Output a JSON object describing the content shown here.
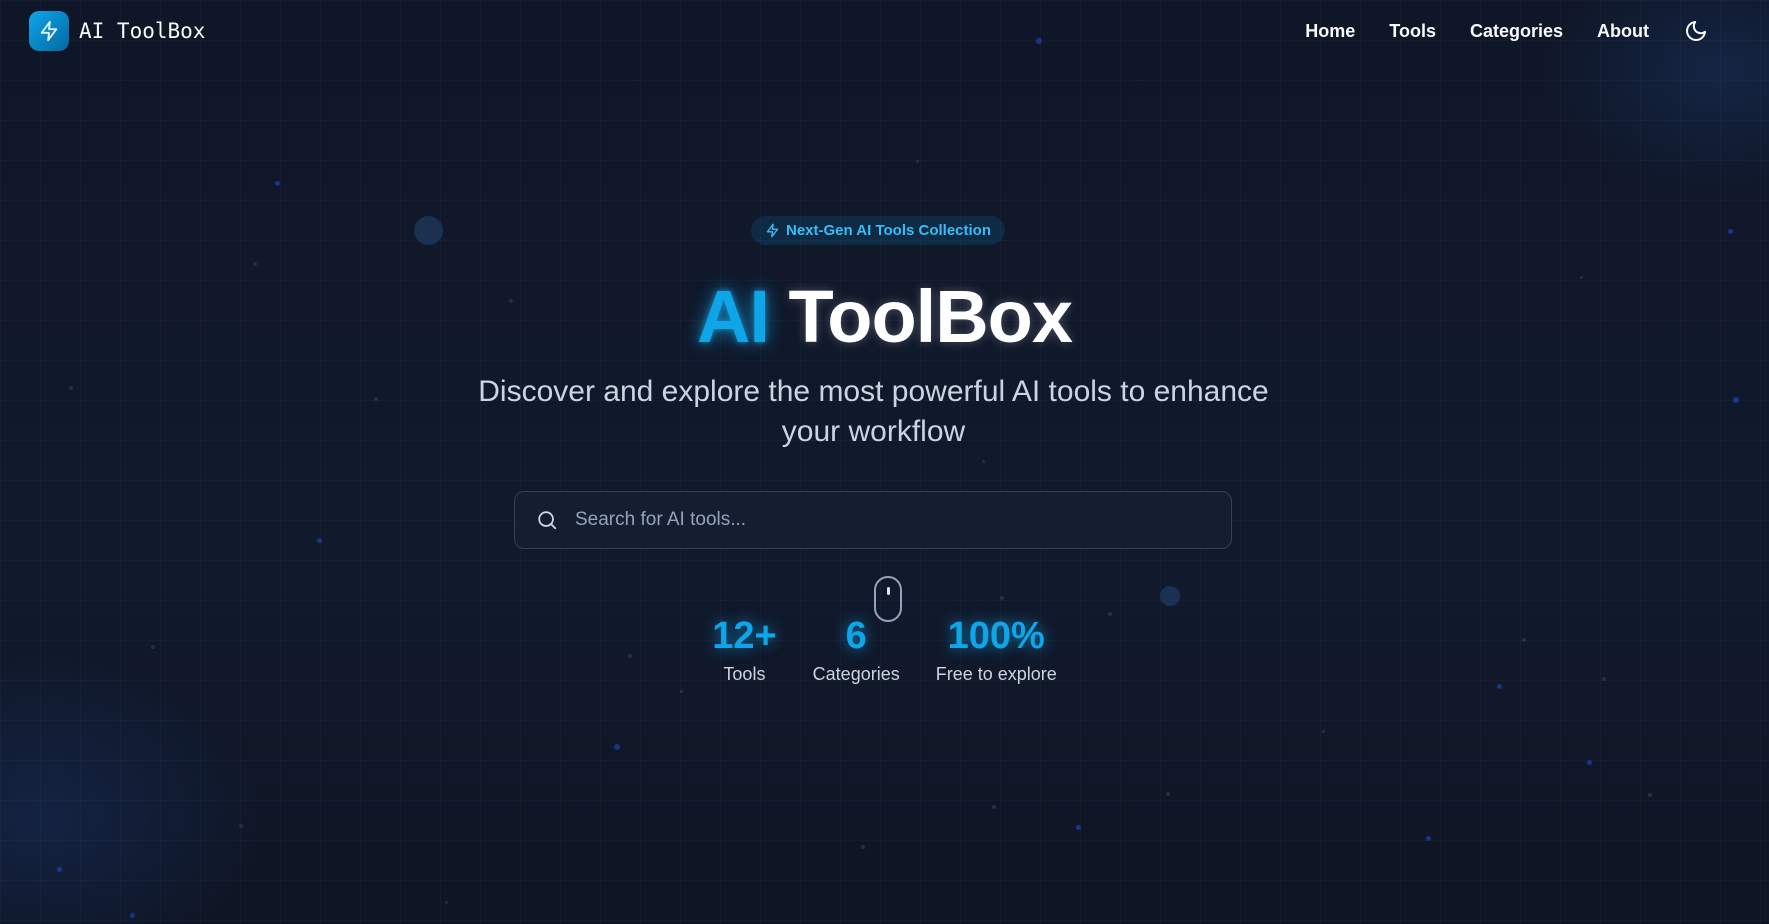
{
  "brand": {
    "name": "AI ToolBox",
    "icon": "lightning-bolt-icon",
    "accent": "#0ea5e9"
  },
  "nav": {
    "links": [
      {
        "label": "Home"
      },
      {
        "label": "Tools"
      },
      {
        "label": "Categories"
      },
      {
        "label": "About"
      }
    ],
    "theme_toggle_icon": "moon-icon"
  },
  "hero": {
    "badge": "Next-Gen AI Tools Collection",
    "title_accent": "AI",
    "title_rest": "ToolBox",
    "subtitle": "Discover and explore the most powerful AI tools to enhance your workflow"
  },
  "search": {
    "placeholder": "Search for AI tools...",
    "value": ""
  },
  "stats": [
    {
      "value": "12+",
      "label": "Tools"
    },
    {
      "value": "6",
      "label": "Categories"
    },
    {
      "value": "100%",
      "label": "Free to explore"
    }
  ]
}
